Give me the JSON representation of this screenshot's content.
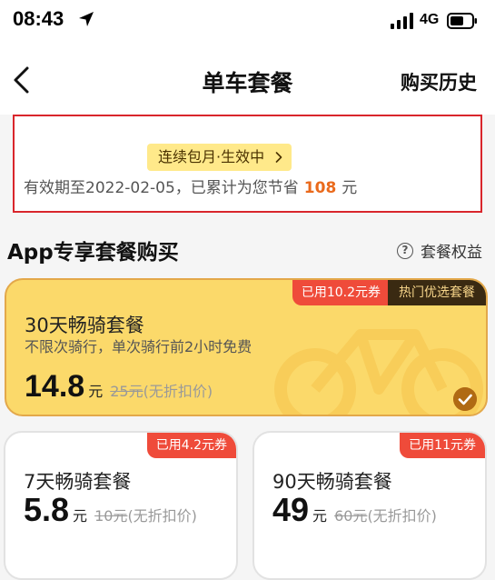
{
  "status_bar": {
    "time": "08:43",
    "network": "4G"
  },
  "nav": {
    "title": "单车套餐",
    "history": "购买历史"
  },
  "membership": {
    "tag": "连续包月·生效中",
    "validity_prefix": "有效期至2022-02-05，已累计为您节省",
    "saved_amount": "108",
    "saved_unit": "元"
  },
  "section": {
    "title": "App专享套餐购买",
    "benefits": "套餐权益",
    "help_symbol": "?"
  },
  "featured_plan": {
    "coupon": "已用10.2元券",
    "hot_label": "热门优选套餐",
    "name": "30天畅骑套餐",
    "description": "不限次骑行，单次骑行前2小时免费",
    "price": "14.8",
    "unit": "元",
    "original": "25元",
    "original_note": "(无折扣价)",
    "selected": true
  },
  "plans": [
    {
      "coupon": "已用4.2元券",
      "name": "7天畅骑套餐",
      "price": "5.8",
      "unit": "元",
      "original": "10元",
      "original_note": "(无折扣价)"
    },
    {
      "coupon": "已用11元券",
      "name": "90天畅骑套餐",
      "price": "49",
      "unit": "元",
      "original": "60元",
      "original_note": "(无折扣价)"
    }
  ],
  "colors": {
    "highlight_border": "#d9262c",
    "saved_amount": "#ea6a1c",
    "featured_bg": "#fbd96a",
    "coupon_red": "#ef4b3a",
    "hot_badge": "#3a2a12"
  },
  "icons": [
    "location-arrow-icon",
    "signal-icon",
    "battery-icon",
    "chevron-left-icon",
    "chevron-right-icon",
    "help-icon",
    "bike-icon",
    "check-icon"
  ]
}
